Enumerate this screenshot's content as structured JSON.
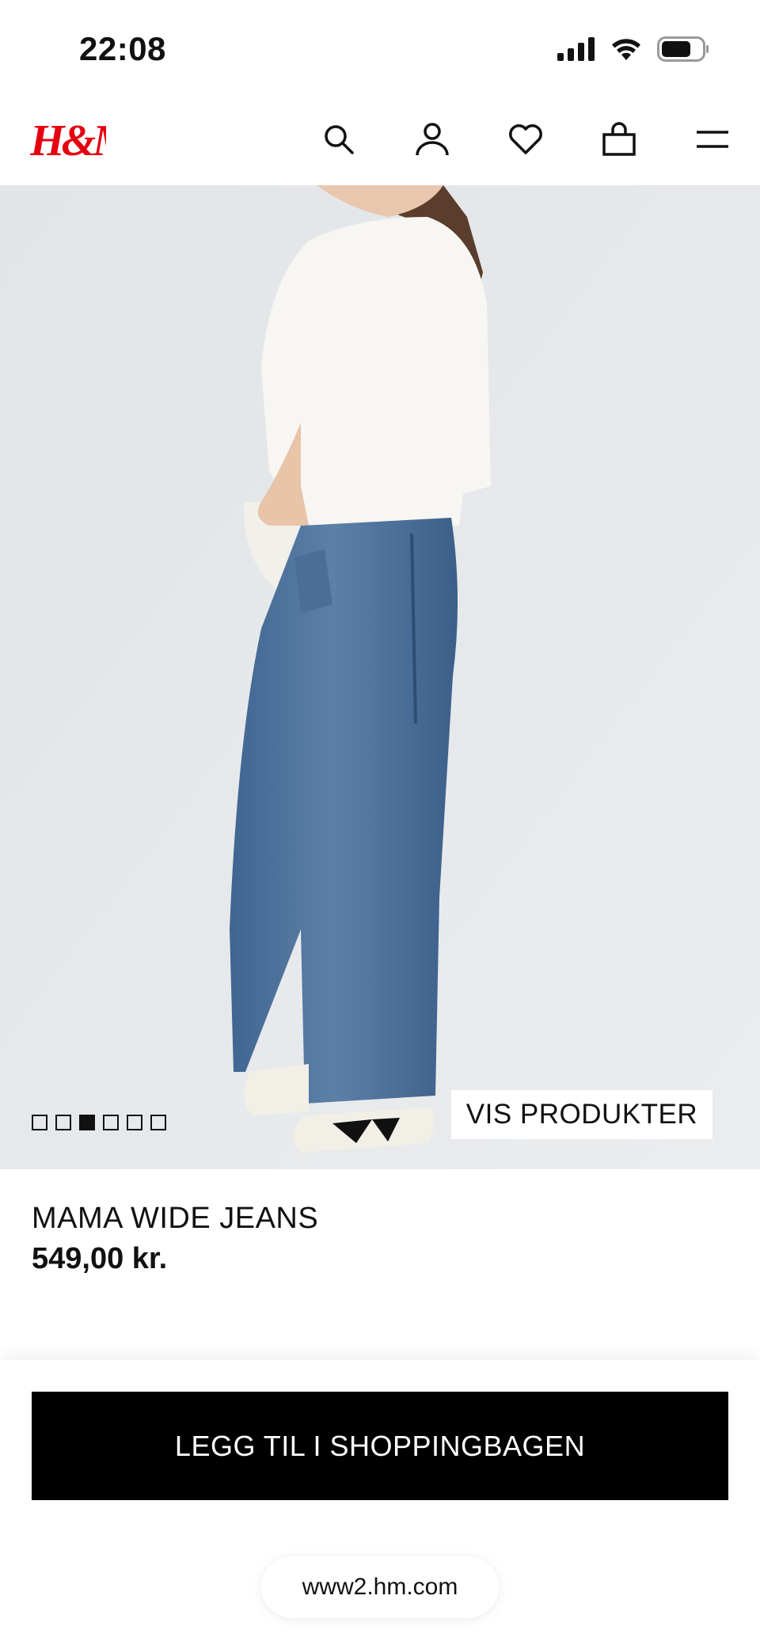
{
  "status_bar": {
    "time": "22:08",
    "icons": [
      "signal-icon",
      "wifi-icon",
      "battery-icon"
    ]
  },
  "header": {
    "logo": "H&M",
    "brand_color": "#e50010",
    "icons": [
      "search-icon",
      "account-icon",
      "heart-icon",
      "shopping-bag-icon",
      "menu-icon"
    ]
  },
  "hero": {
    "image": "model wearing wide-leg blue jeans and white t-shirt",
    "carousel": {
      "count": 6,
      "active_index": 2
    },
    "cta_label": "VIS PRODUKTER"
  },
  "product": {
    "name": "MAMA WIDE JEANS",
    "price": "549,00 kr."
  },
  "actions": {
    "add_to_bag_label": "LEGG TIL I SHOPPINGBAGEN"
  },
  "browser": {
    "url": "www2.hm.com"
  }
}
